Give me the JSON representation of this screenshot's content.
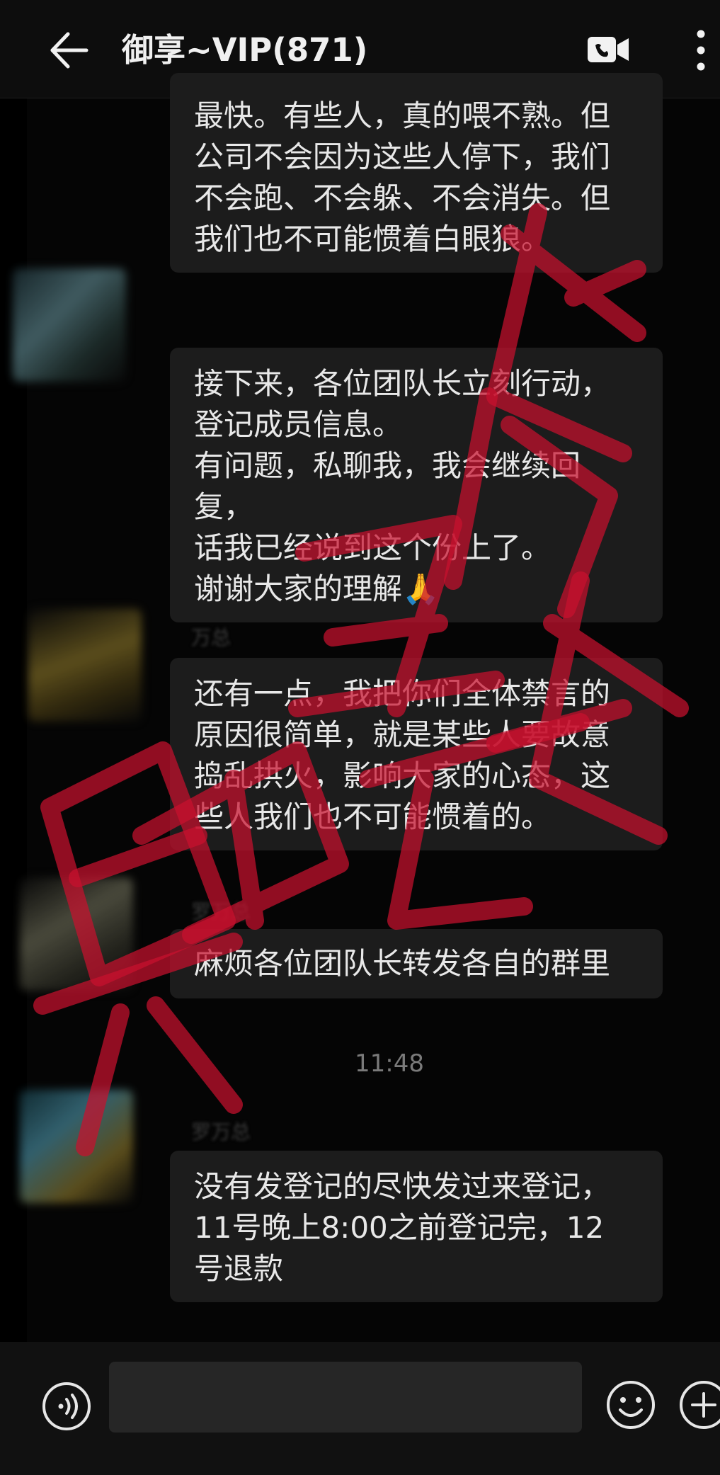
{
  "header": {
    "title": "御享~VIP(871)",
    "back_icon": "arrow-left-icon",
    "video_icon": "video-call-icon",
    "more_icon": "more-vertical-icon"
  },
  "messages": [
    {
      "text": "最快。有些人，真的喂不熟。但\n公司不会因为这些人停下，我们\n不会跑、不会躲、不会消失。但\n我们也不可能惯着白眼狼。"
    },
    {
      "text": "接下来，各位团队长立刻行动，\n登记成员信息。\n有问题，私聊我，我会继续回复，\n话我已经说到这个份上了。\n谢谢大家的理解🙏"
    },
    {
      "sender": "万总",
      "text": "还有一点，我把你们全体禁言的\n原因很简单，就是某些人要故意\n捣乱拱火，影响大家的心态，这\n些人我们也不可能惯着的。"
    },
    {
      "sender": "罗万总",
      "text": "麻烦各位团队长转发各自的群里"
    },
    {
      "sender": "罗万总",
      "text": "没有发登记的尽快发过来登记，\n11号晚上8:00之前登记完，12\n号退款"
    }
  ],
  "timestamp": "11:48",
  "watermark": {
    "text_line1": "骗子",
    "text_line2": "果断",
    "color": "#c8102e"
  },
  "input_bar": {
    "voice_icon": "voice-input-icon",
    "emoji_icon": "emoji-icon",
    "plus_icon": "plus-icon",
    "placeholder": ""
  },
  "colors": {
    "background": "#000000",
    "bubble": "#1c1c1c",
    "text": "#e8e8e8"
  }
}
